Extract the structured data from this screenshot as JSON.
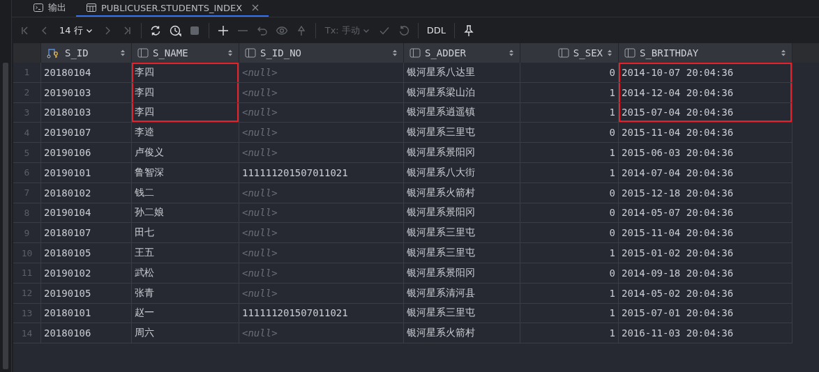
{
  "tabs": [
    {
      "kind": "console",
      "label": "输出",
      "selected": false,
      "closable": false
    },
    {
      "kind": "table",
      "label": "PUBLICUSER.STUDENTS_INDEX",
      "selected": true,
      "closable": true
    }
  ],
  "toolbar": [
    {
      "kind": "first",
      "disabled": true
    },
    {
      "kind": "prev",
      "disabled": true
    },
    {
      "kind": "dropdown",
      "label": "14 行",
      "disabled": false
    },
    {
      "kind": "next",
      "disabled": true
    },
    {
      "kind": "last",
      "disabled": true
    },
    {
      "kind": "sep"
    },
    {
      "kind": "refresh",
      "disabled": false
    },
    {
      "kind": "history",
      "disabled": false
    },
    {
      "kind": "stop",
      "disabled": true
    },
    {
      "kind": "sep"
    },
    {
      "kind": "add",
      "disabled": false
    },
    {
      "kind": "remove",
      "disabled": true
    },
    {
      "kind": "undo",
      "disabled": true
    },
    {
      "kind": "preview",
      "disabled": true
    },
    {
      "kind": "submit",
      "disabled": true
    },
    {
      "kind": "sep"
    },
    {
      "kind": "dropdown",
      "label": "Tx: 手动",
      "disabled": true
    },
    {
      "kind": "commit",
      "disabled": true
    },
    {
      "kind": "rollback",
      "disabled": true
    },
    {
      "kind": "sep"
    },
    {
      "kind": "text",
      "label": "DDL",
      "disabled": false
    },
    {
      "kind": "sep"
    },
    {
      "kind": "pin",
      "disabled": false
    }
  ],
  "table": {
    "columns": [
      {
        "name": "S_ID",
        "kind": "text",
        "key": true
      },
      {
        "name": "S_NAME",
        "kind": "text",
        "key": false
      },
      {
        "name": "S_ID_NO",
        "kind": "text",
        "key": false
      },
      {
        "name": "S_ADDER",
        "kind": "text",
        "key": false
      },
      {
        "name": "S_SEX",
        "kind": "number",
        "key": false
      },
      {
        "name": "S_BRITHDAY",
        "kind": "text",
        "key": false
      }
    ],
    "rows": [
      {
        "number": "1",
        "outlined": [
          false,
          true,
          false,
          false,
          false,
          true
        ],
        "cells": [
          "20180104",
          "李四",
          {
            "kind": "null",
            "text": "<null>"
          },
          "银河星系八达里",
          "0",
          "2014-10-07 20:04:36"
        ]
      },
      {
        "number": "2",
        "outlined": [
          false,
          true,
          false,
          false,
          false,
          true
        ],
        "cells": [
          "20190103",
          "李四",
          {
            "kind": "null",
            "text": "<null>"
          },
          "银河星系梁山泊",
          "1",
          "2014-12-04 20:04:36"
        ]
      },
      {
        "number": "3",
        "outlined": [
          false,
          true,
          false,
          false,
          false,
          true
        ],
        "cells": [
          "20180103",
          "李四",
          {
            "kind": "null",
            "text": "<null>"
          },
          "银河星系逍遥镇",
          "1",
          "2015-07-04 20:04:36"
        ]
      },
      {
        "number": "4",
        "outlined": [
          false,
          false,
          false,
          false,
          false,
          false
        ],
        "cells": [
          "20190107",
          "李逵",
          {
            "kind": "null",
            "text": "<null>"
          },
          "银河星系三里屯",
          "0",
          "2015-11-04 20:04:36"
        ]
      },
      {
        "number": "5",
        "outlined": [
          false,
          false,
          false,
          false,
          false,
          false
        ],
        "cells": [
          "20190106",
          "卢俊义",
          {
            "kind": "null",
            "text": "<null>"
          },
          "银河星系景阳冈",
          "1",
          "2015-06-03 20:04:36"
        ]
      },
      {
        "number": "6",
        "outlined": [
          false,
          false,
          false,
          false,
          false,
          false
        ],
        "cells": [
          "20190101",
          "鲁智深",
          "111111201507011021",
          "银河星系八大街",
          "1",
          "2014-07-04 20:04:36"
        ]
      },
      {
        "number": "7",
        "outlined": [
          false,
          false,
          false,
          false,
          false,
          false
        ],
        "cells": [
          "20180102",
          "钱二",
          {
            "kind": "null",
            "text": "<null>"
          },
          "银河星系火箭村",
          "0",
          "2015-12-18 20:04:36"
        ]
      },
      {
        "number": "8",
        "outlined": [
          false,
          false,
          false,
          false,
          false,
          false
        ],
        "cells": [
          "20190104",
          "孙二娘",
          {
            "kind": "null",
            "text": "<null>"
          },
          "银河星系景阳冈",
          "0",
          "2014-05-07 20:04:36"
        ]
      },
      {
        "number": "9",
        "outlined": [
          false,
          false,
          false,
          false,
          false,
          false
        ],
        "cells": [
          "20180107",
          "田七",
          {
            "kind": "null",
            "text": "<null>"
          },
          "银河星系三里屯",
          "0",
          "2015-11-04 20:04:36"
        ]
      },
      {
        "number": "10",
        "outlined": [
          false,
          false,
          false,
          false,
          false,
          false
        ],
        "cells": [
          "20180105",
          "王五",
          {
            "kind": "null",
            "text": "<null>"
          },
          "银河星系三里屯",
          "1",
          "2015-01-02 20:04:36"
        ]
      },
      {
        "number": "11",
        "outlined": [
          false,
          false,
          false,
          false,
          false,
          false
        ],
        "cells": [
          "20190102",
          "武松",
          {
            "kind": "null",
            "text": "<null>"
          },
          "银河星系景阳冈",
          "0",
          "2014-09-18 20:04:36"
        ]
      },
      {
        "number": "12",
        "outlined": [
          false,
          false,
          false,
          false,
          false,
          false
        ],
        "cells": [
          "20190105",
          "张青",
          {
            "kind": "null",
            "text": "<null>"
          },
          "银河星系清河县",
          "1",
          "2014-05-02 20:04:36"
        ]
      },
      {
        "number": "13",
        "outlined": [
          false,
          false,
          false,
          false,
          false,
          false
        ],
        "cells": [
          "20180101",
          "赵一",
          "111111201507011021",
          "银河星系三里屯",
          "1",
          "2015-07-01 20:04:36"
        ]
      },
      {
        "number": "14",
        "outlined": [
          false,
          false,
          false,
          false,
          false,
          false
        ],
        "cells": [
          "20180106",
          "周六",
          {
            "kind": "null",
            "text": "<null>"
          },
          "银河星系火箭村",
          "1",
          "2016-11-03 20:04:36"
        ]
      }
    ]
  }
}
